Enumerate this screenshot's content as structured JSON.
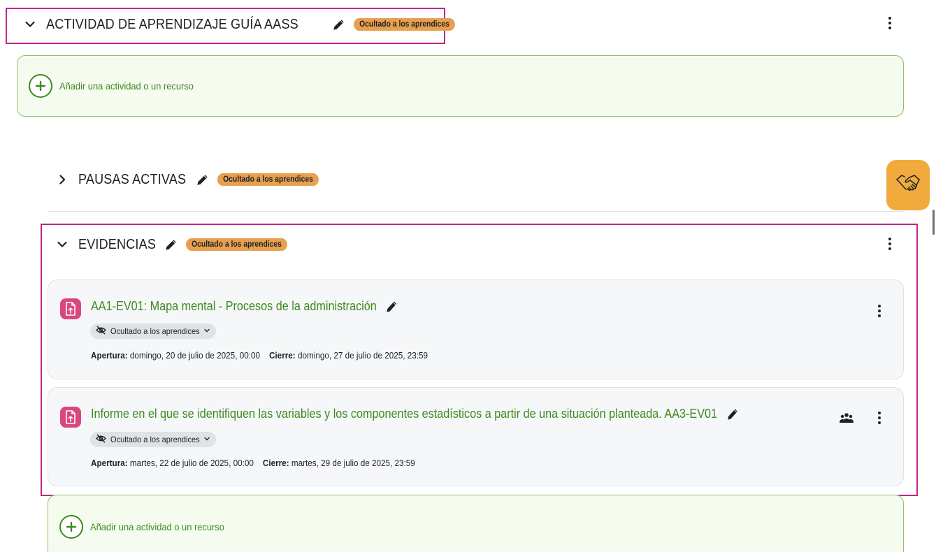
{
  "sections": {
    "actividad": {
      "title": "ACTIVIDAD DE APRENDIZAJE GUÍA AASS",
      "badge": "Ocultado a los aprendices"
    },
    "pausas": {
      "title": "PAUSAS ACTIVAS",
      "badge": "Ocultado a los aprendices"
    },
    "evidencias": {
      "title": "EVIDENCIAS",
      "badge": "Ocultado a los aprendices"
    }
  },
  "add_activity": {
    "label": "Añadir una actividad o un recurso"
  },
  "activities": [
    {
      "title": "AA1-EV01: Mapa mental - Procesos de la administración",
      "visibility": "Ocultado a los aprendices",
      "opening_label": "Apertura:",
      "opening_value": "domingo, 20 de julio de 2025, 00:00",
      "closing_label": "Cierre:",
      "closing_value": "domingo, 27 de julio de 2025, 23:59"
    },
    {
      "title": "Informe en el que se identifiquen las variables y los componentes estadísticos a partir de una situación planteada. AA3-EV01",
      "visibility": "Ocultado a los aprendices",
      "opening_label": "Apertura:",
      "opening_value": "martes, 22 de julio de 2025, 00:00",
      "closing_label": "Cierre:",
      "closing_value": "martes, 29 de julio de 2025, 23:59"
    }
  ],
  "colors": {
    "highlight": "#c0268a",
    "badge": "#e7a04f",
    "link_green": "#3d8a1f",
    "assign_icon": "#d9477e",
    "fab": "#f0ab3c"
  },
  "icons": [
    "chevron-down-icon",
    "chevron-right-icon",
    "pencil-icon",
    "kebab-menu-icon",
    "plus-icon",
    "assignment-icon",
    "eye-slash-icon",
    "users-icon",
    "handshake-icon"
  ]
}
